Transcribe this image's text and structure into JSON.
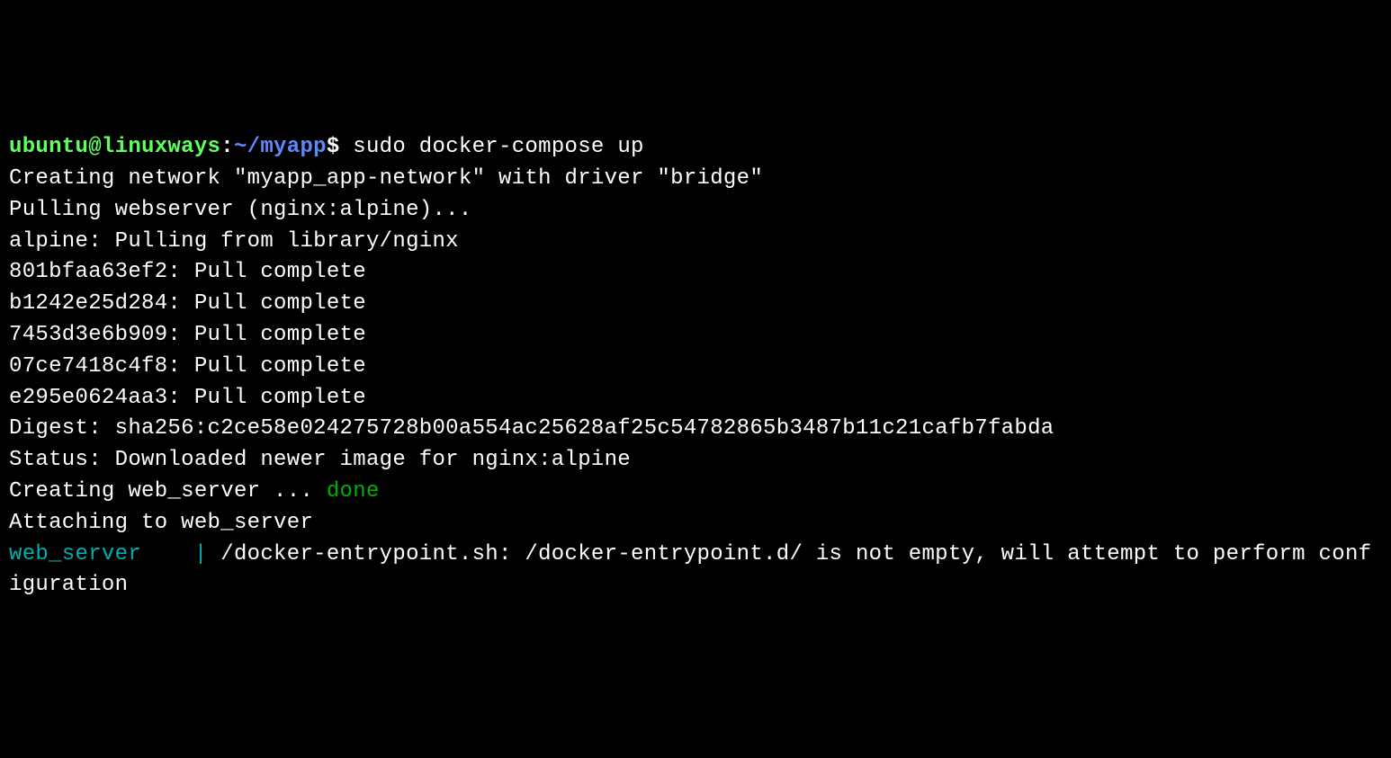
{
  "prompt": {
    "user": "ubuntu@linuxways",
    "sep": ":",
    "path": "~/myapp",
    "dollar": "$"
  },
  "command": " sudo docker-compose up",
  "lines": {
    "creating_network": "Creating network \"myapp_app-network\" with driver \"bridge\"",
    "pulling_webserver": "Pulling webserver (nginx:alpine)...",
    "alpine_pulling": "alpine: Pulling from library/nginx",
    "layer1": "801bfaa63ef2: Pull complete",
    "layer2": "b1242e25d284: Pull complete",
    "layer3": "7453d3e6b909: Pull complete",
    "layer4": "07ce7418c4f8: Pull complete",
    "layer5": "e295e0624aa3: Pull complete",
    "digest": "Digest: sha256:c2ce58e024275728b00a554ac25628af25c54782865b3487b11c21cafb7fabda",
    "status": "Status: Downloaded newer image for nginx:alpine",
    "creating_prefix": "Creating web_server ... ",
    "done": "done",
    "attaching": "Attaching to web_server",
    "service_name": "web_server   ",
    "log_sep": " |",
    "log_msg": " /docker-entrypoint.sh: /docker-entrypoint.d/ is not empty, will attempt to perform configuration"
  }
}
